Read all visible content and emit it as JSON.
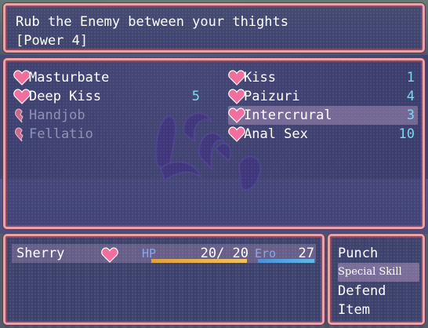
{
  "help": {
    "line1": "Rub the Enemy between your thights",
    "line2": "[Power 4]"
  },
  "skills": [
    {
      "name": "Masturbate",
      "cost": "",
      "enabled": true,
      "icon": "heart-icon"
    },
    {
      "name": "Kiss",
      "cost": "1",
      "enabled": true,
      "icon": "heart-icon"
    },
    {
      "name": "Deep Kiss",
      "cost": "5",
      "enabled": true,
      "icon": "heart-icon"
    },
    {
      "name": "Paizuri",
      "cost": "4",
      "enabled": true,
      "icon": "heart-icon"
    },
    {
      "name": "Handjob",
      "cost": "",
      "enabled": false,
      "icon": "broken-heart-icon"
    },
    {
      "name": "Intercrural",
      "cost": "3",
      "enabled": true,
      "icon": "heart-icon",
      "selected": true
    },
    {
      "name": "Fellatio",
      "cost": "",
      "enabled": false,
      "icon": "broken-heart-icon"
    },
    {
      "name": "Anal Sex",
      "cost": "10",
      "enabled": true,
      "icon": "heart-icon"
    }
  ],
  "status": {
    "actor_name": "Sherry",
    "state_icon": "heart-icon",
    "hp_label": "HP",
    "hp_value": "20/  20",
    "hp_fraction": 1.0,
    "ero_label": "Ero",
    "ero_value": "27",
    "ero_fraction": 1.0
  },
  "commands": [
    {
      "label": "Punch",
      "selected": false
    },
    {
      "label": "Special Skill",
      "selected": true
    },
    {
      "label": "Defend",
      "selected": false
    },
    {
      "label": "Item",
      "selected": false
    }
  ],
  "colors": {
    "window_border": "#e8a4a8",
    "cost_text": "#7fd6f0",
    "hp_gauge": "#e0a040",
    "ero_gauge": "#4aa8e0",
    "heart": "#f26e9e"
  }
}
